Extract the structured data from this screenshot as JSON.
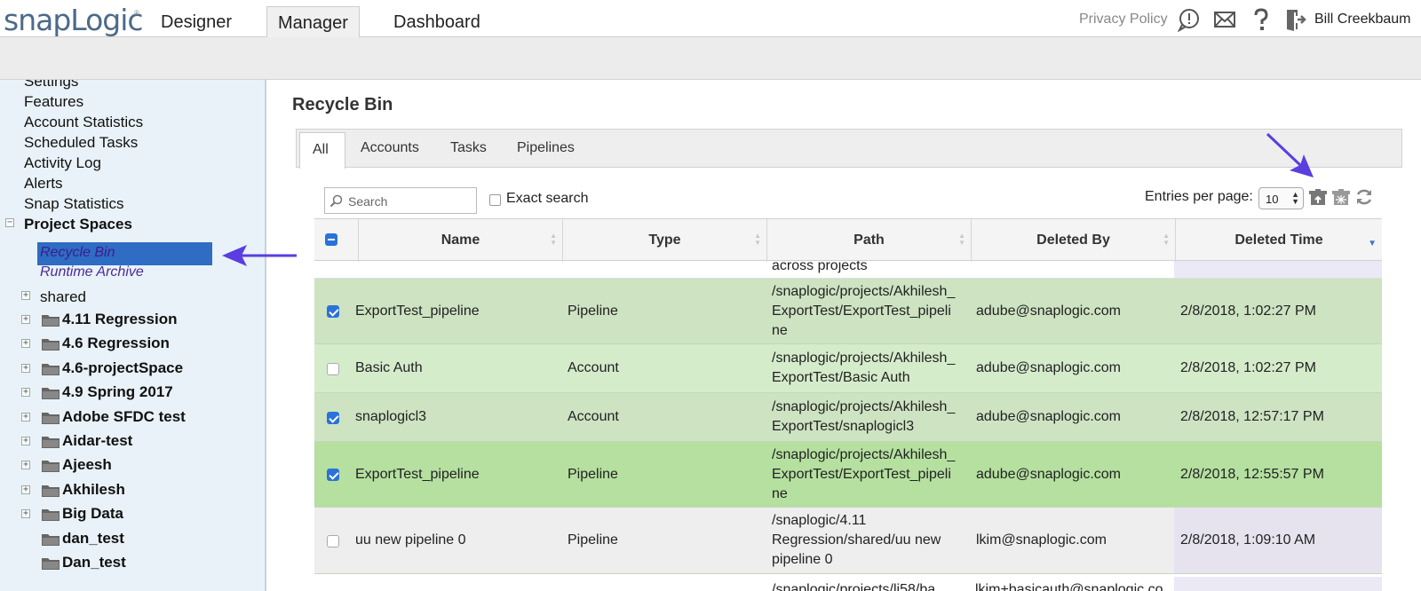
{
  "header": {
    "logo_main": "snapLogic",
    "logo_tm": "®",
    "tabs": [
      {
        "label": "Designer"
      },
      {
        "label": "Manager"
      },
      {
        "label": "Dashboard"
      }
    ],
    "active_tab": "Manager",
    "privacy_label": "Privacy Policy",
    "user_name": "Bill Creekbaum",
    "icons": [
      "feedback-icon",
      "mail-icon",
      "help-icon",
      "logout-icon"
    ]
  },
  "sidebar": {
    "items": [
      {
        "label": "Settings"
      },
      {
        "label": "Features"
      },
      {
        "label": "Account Statistics"
      },
      {
        "label": "Scheduled Tasks"
      },
      {
        "label": "Activity Log"
      },
      {
        "label": "Alerts"
      },
      {
        "label": "Snap Statistics"
      }
    ],
    "project_spaces_label": "Project Spaces",
    "sub_items": [
      {
        "label": "Recycle Bin"
      },
      {
        "label": "Runtime Archive"
      }
    ],
    "shared_label": "shared",
    "folders": [
      {
        "label": "4.11 Regression"
      },
      {
        "label": "4.6 Regression"
      },
      {
        "label": "4.6-projectSpace"
      },
      {
        "label": "4.9 Spring 2017"
      },
      {
        "label": "Adobe SFDC test"
      },
      {
        "label": "Aidar-test"
      },
      {
        "label": "Ajeesh"
      },
      {
        "label": "Akhilesh"
      },
      {
        "label": "Big Data"
      },
      {
        "label": "dan_test"
      },
      {
        "label": "Dan_test"
      }
    ]
  },
  "main": {
    "title": "Recycle Bin",
    "tabs": [
      {
        "label": "All"
      },
      {
        "label": "Accounts"
      },
      {
        "label": "Tasks"
      },
      {
        "label": "Pipelines"
      }
    ],
    "search_placeholder": "Search",
    "exact_search_label": "Exact search",
    "entries_label": "Entries per page:",
    "entries_value": "10",
    "entries_arrows": "▲\n▼",
    "action_icons": [
      "restore-icon",
      "delete-permanently-icon",
      "refresh-icon"
    ]
  },
  "table": {
    "columns": [
      {
        "label": "Name"
      },
      {
        "label": "Type"
      },
      {
        "label": "Path"
      },
      {
        "label": "Deleted By"
      },
      {
        "label": "Deleted Time"
      }
    ],
    "sort_glyph": "▲\n▼",
    "sorted_glyph": "▼",
    "partial_top_path": "across projects",
    "rows": [
      {
        "name": "ExportTest_pipeline",
        "type": "Pipeline",
        "path": "/snaplogic/projects/Akhilesh_ExportTest/ExportTest_pipeline",
        "path_lines": [
          "/snaplogic/projects/Akhilesh_",
          "ExportTest/ExportTest_pipeli",
          "ne"
        ],
        "deleted_by": "adube@snaplogic.com",
        "deleted_time": "2/8/2018, 1:02:27 PM",
        "checked": true
      },
      {
        "name": "Basic Auth",
        "type": "Account",
        "path": "/snaplogic/projects/Akhilesh_ExportTest/Basic Auth",
        "path_lines": [
          "/snaplogic/projects/Akhilesh_",
          "ExportTest/Basic Auth"
        ],
        "deleted_by": "adube@snaplogic.com",
        "deleted_time": "2/8/2018, 1:02:27 PM",
        "checked": false
      },
      {
        "name": "snaplogicl3",
        "type": "Account",
        "path": "/snaplogic/projects/Akhilesh_ExportTest/snaplogicl3",
        "path_lines": [
          "/snaplogic/projects/Akhilesh_",
          "ExportTest/snaplogicl3"
        ],
        "deleted_by": "adube@snaplogic.com",
        "deleted_time": "2/8/2018, 12:57:17 PM",
        "checked": true
      },
      {
        "name": "ExportTest_pipeline",
        "type": "Pipeline",
        "path": "/snaplogic/projects/Akhilesh_ExportTest/ExportTest_pipeline",
        "path_lines": [
          "/snaplogic/projects/Akhilesh_",
          "ExportTest/ExportTest_pipeli",
          "ne"
        ],
        "deleted_by": "adube@snaplogic.com",
        "deleted_time": "2/8/2018, 12:55:57 PM",
        "checked": true
      },
      {
        "name": "uu new pipeline 0",
        "type": "Pipeline",
        "path": "/snaplogic/4.11 Regression/shared/uu new pipeline 0",
        "path_lines": [
          "/snaplogic/4.11",
          "Regression/shared/uu new",
          "pipeline 0"
        ],
        "deleted_by": "lkim@snaplogic.com",
        "deleted_time": "2/8/2018, 1:09:10 AM",
        "checked": false
      }
    ],
    "partial_bottom_path": "/snaplogic/projects/li58/ba",
    "partial_bottom_by": "lkim+basicauth@snaplogic.co"
  },
  "colors": {
    "accent": "#2a72d8",
    "sidebar_bg": "#e9f2f8",
    "selected_nav": "#2f6cc3",
    "row_green_1": "#cde3c2",
    "row_green_2": "#d5eccb",
    "row_green_3": "#b5e0a0",
    "row_gray": "#eeeeee",
    "annotation_arrow": "#5a3ee0"
  }
}
